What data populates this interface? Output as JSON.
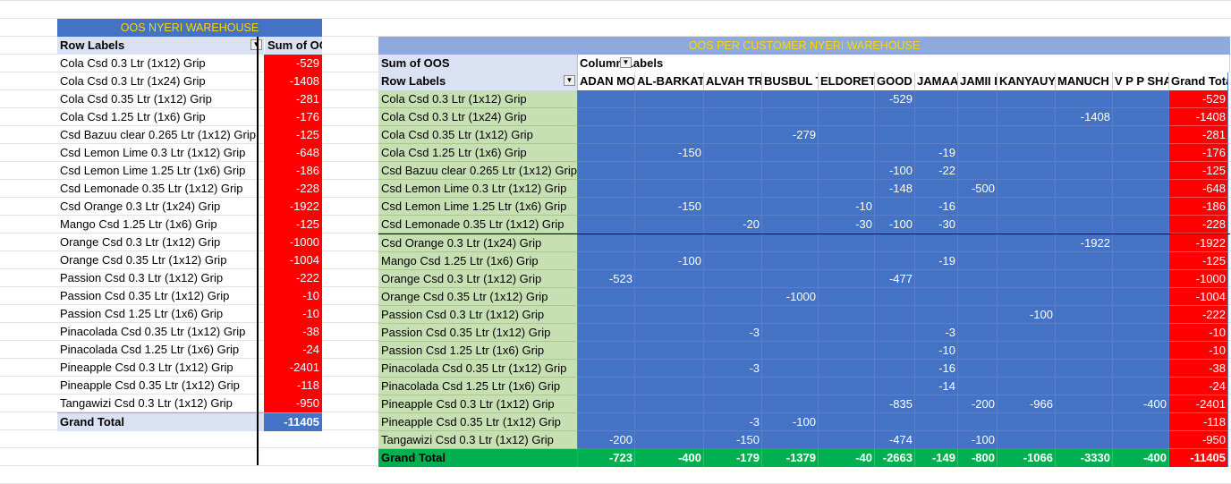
{
  "left_pivot": {
    "title": "OOS NYERI WAREHOUSE",
    "header_label": "Row Labels",
    "header_value": "Sum of OOS",
    "filter_glyph": "▼",
    "rows": [
      {
        "label": "Cola Csd 0.3 Ltr (1x12) Grip",
        "value": "-529"
      },
      {
        "label": "Cola Csd 0.3 Ltr (1x24) Grip",
        "value": "-1408"
      },
      {
        "label": "Cola Csd 0.35 Ltr (1x12) Grip",
        "value": "-281"
      },
      {
        "label": "Cola Csd 1.25 Ltr (1x6) Grip",
        "value": "-176"
      },
      {
        "label": "Csd Bazuu clear 0.265 Ltr (1x12) Grip",
        "value": "-125"
      },
      {
        "label": "Csd Lemon Lime 0.3 Ltr (1x12) Grip",
        "value": "-648"
      },
      {
        "label": "Csd Lemon Lime 1.25 Ltr (1x6) Grip",
        "value": "-186"
      },
      {
        "label": "Csd Lemonade 0.35 Ltr (1x12) Grip",
        "value": "-228"
      },
      {
        "label": "Csd Orange 0.3  Ltr (1x24)  Grip",
        "value": "-1922"
      },
      {
        "label": "Mango Csd 1.25 Ltr (1x6) Grip",
        "value": "-125"
      },
      {
        "label": "Orange Csd 0.3 Ltr (1x12) Grip",
        "value": "-1000"
      },
      {
        "label": "Orange Csd 0.35 Ltr (1x12) Grip",
        "value": "-1004"
      },
      {
        "label": "Passion Csd 0.3 Ltr (1x12) Grip",
        "value": "-222"
      },
      {
        "label": "Passion Csd 0.35 Ltr (1x12) Grip",
        "value": "-10"
      },
      {
        "label": "Passion Csd 1.25 Ltr (1x6) Grip",
        "value": "-10"
      },
      {
        "label": "Pinacolada Csd 0.35 Ltr (1x12) Grip",
        "value": "-38"
      },
      {
        "label": "Pinacolada Csd 1.25 Ltr (1x6) Grip",
        "value": "-24"
      },
      {
        "label": "Pineapple Csd 0.3 Ltr (1x12) Grip",
        "value": "-2401"
      },
      {
        "label": "Pineapple Csd 0.35 Ltr (1x12) Grip",
        "value": "-118"
      },
      {
        "label": "Tangawizi Csd 0.3 Ltr (1x12) Grip",
        "value": "-950"
      }
    ],
    "total_label": "Grand Total",
    "total_value": "-11405"
  },
  "right_pivot": {
    "title": "OOS PER CUSTOMER NYERI WAREHOUSE",
    "sum_label": "Sum of OOS",
    "column_labels": "Column Labels",
    "row_labels": "Row Labels",
    "filter_glyph": "▼",
    "columns": [
      "ADAN MO",
      "AL-BARKAT S",
      "ALVAH TR",
      "BUSBUL T",
      "ELDORET P",
      "GOOD",
      "JAMAA",
      "JAMII D",
      "KANYAUY",
      "MANUCH",
      "V P P SHA"
    ],
    "grand_total_label": "Grand Total",
    "rows": [
      {
        "label": "Cola Csd 0.3 Ltr (1x12) Grip",
        "cells": [
          "",
          "",
          "",
          "",
          "",
          "-529",
          "",
          "",
          "",
          "",
          ""
        ],
        "total": "-529"
      },
      {
        "label": "Cola Csd 0.3 Ltr (1x24) Grip",
        "cells": [
          "",
          "",
          "",
          "",
          "",
          "",
          "",
          "",
          "",
          "-1408",
          ""
        ],
        "total": "-1408"
      },
      {
        "label": "Cola Csd 0.35 Ltr (1x12) Grip",
        "cells": [
          "",
          "",
          "",
          "-279",
          "",
          "",
          "",
          "",
          "",
          "",
          ""
        ],
        "total": "-281"
      },
      {
        "label": "Cola Csd 1.25 Ltr (1x6) Grip",
        "cells": [
          "",
          "-150",
          "",
          "",
          "",
          "",
          "-19",
          "",
          "",
          "",
          ""
        ],
        "total": "-176"
      },
      {
        "label": "Csd Bazuu clear 0.265 Ltr (1x12) Grip",
        "cells": [
          "",
          "",
          "",
          "",
          "",
          "-100",
          "-22",
          "",
          "",
          "",
          ""
        ],
        "total": "-125"
      },
      {
        "label": "Csd Lemon Lime 0.3 Ltr (1x12) Grip",
        "cells": [
          "",
          "",
          "",
          "",
          "",
          "-148",
          "",
          "-500",
          "",
          "",
          ""
        ],
        "total": "-648"
      },
      {
        "label": "Csd Lemon Lime 1.25 Ltr (1x6) Grip",
        "cells": [
          "",
          "-150",
          "",
          "",
          "-10",
          "",
          "-16",
          "",
          "",
          "",
          ""
        ],
        "total": "-186"
      },
      {
        "label": "Csd Lemonade 0.35 Ltr (1x12) Grip",
        "cells": [
          "",
          "",
          "-20",
          "",
          "-30",
          "-100",
          "-30",
          "",
          "",
          "",
          ""
        ],
        "total": "-228"
      },
      {
        "label": "Csd Orange 0.3  Ltr (1x24)  Grip",
        "cells": [
          "",
          "",
          "",
          "",
          "",
          "",
          "",
          "",
          "",
          "-1922",
          ""
        ],
        "total": "-1922"
      },
      {
        "label": "Mango Csd 1.25 Ltr (1x6) Grip",
        "cells": [
          "",
          "-100",
          "",
          "",
          "",
          "",
          "-19",
          "",
          "",
          "",
          ""
        ],
        "total": "-125"
      },
      {
        "label": "Orange Csd 0.3 Ltr (1x12) Grip",
        "cells": [
          "-523",
          "",
          "",
          "",
          "",
          "-477",
          "",
          "",
          "",
          "",
          ""
        ],
        "total": "-1000"
      },
      {
        "label": "Orange Csd 0.35 Ltr (1x12) Grip",
        "cells": [
          "",
          "",
          "",
          "-1000",
          "",
          "",
          "",
          "",
          "",
          "",
          ""
        ],
        "total": "-1004"
      },
      {
        "label": "Passion Csd 0.3 Ltr (1x12) Grip",
        "cells": [
          "",
          "",
          "",
          "",
          "",
          "",
          "",
          "",
          "-100",
          "",
          ""
        ],
        "total": "-222"
      },
      {
        "label": "Passion Csd 0.35 Ltr (1x12) Grip",
        "cells": [
          "",
          "",
          "-3",
          "",
          "",
          "",
          "-3",
          "",
          "",
          "",
          ""
        ],
        "total": "-10"
      },
      {
        "label": "Passion Csd 1.25 Ltr (1x6) Grip",
        "cells": [
          "",
          "",
          "",
          "",
          "",
          "",
          "-10",
          "",
          "",
          "",
          ""
        ],
        "total": "-10"
      },
      {
        "label": "Pinacolada Csd 0.35 Ltr (1x12) Grip",
        "cells": [
          "",
          "",
          "-3",
          "",
          "",
          "",
          "-16",
          "",
          "",
          "",
          ""
        ],
        "total": "-38"
      },
      {
        "label": "Pinacolada Csd 1.25 Ltr (1x6) Grip",
        "cells": [
          "",
          "",
          "",
          "",
          "",
          "",
          "-14",
          "",
          "",
          "",
          ""
        ],
        "total": "-24"
      },
      {
        "label": "Pineapple Csd 0.3 Ltr (1x12) Grip",
        "cells": [
          "",
          "",
          "",
          "",
          "",
          "-835",
          "",
          "-200",
          "-966",
          "",
          "-400"
        ],
        "total": "-2401"
      },
      {
        "label": "Pineapple Csd 0.35 Ltr (1x12) Grip",
        "cells": [
          "",
          "",
          "-3",
          "-100",
          "",
          "",
          "",
          "",
          "",
          "",
          ""
        ],
        "total": "-118"
      },
      {
        "label": "Tangawizi Csd 0.3 Ltr (1x12) Grip",
        "cells": [
          "-200",
          "",
          "-150",
          "",
          "",
          "-474",
          "",
          "-100",
          "",
          "",
          ""
        ],
        "total": "-950"
      }
    ],
    "total_label": "Grand Total",
    "total_cells": [
      "-723",
      "-400",
      "-179",
      "-1379",
      "-40",
      "-2663",
      "-149",
      "-800",
      "-1066",
      "-3330",
      "-400"
    ],
    "total_total": "-11405"
  }
}
